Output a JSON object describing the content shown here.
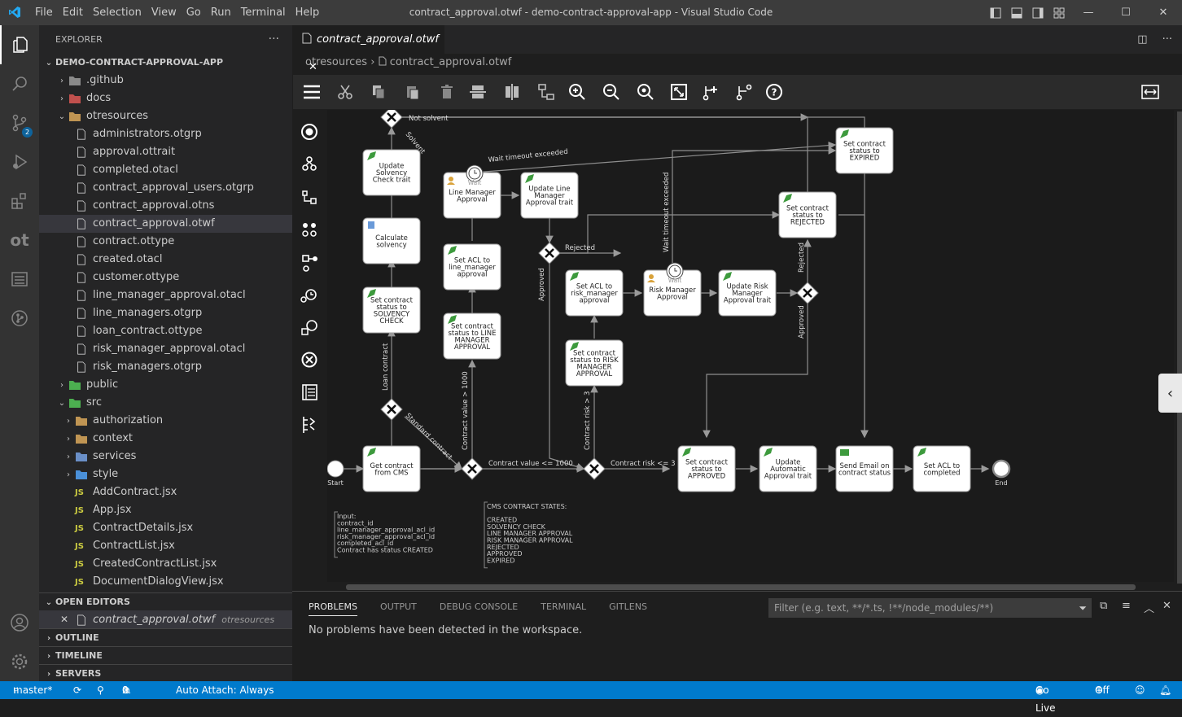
{
  "window": {
    "title": "contract_approval.otwf - demo-contract-approval-app - Visual Studio Code"
  },
  "menu": [
    "File",
    "Edit",
    "Selection",
    "View",
    "Go",
    "Run",
    "Terminal",
    "Help"
  ],
  "activity": {
    "scm_badge": "2"
  },
  "explorer": {
    "title": "EXPLORER",
    "root": "DEMO-CONTRACT-APPROVAL-APP",
    "items": [
      {
        "label": ".github",
        "kind": "folder",
        "depth": 1,
        "state": "closed",
        "color": "#8a8a8a"
      },
      {
        "label": "docs",
        "kind": "folder",
        "depth": 1,
        "state": "closed",
        "color": "#c0504d"
      },
      {
        "label": "otresources",
        "kind": "folder",
        "depth": 1,
        "state": "open",
        "color": "#c09553"
      },
      {
        "label": "administrators.otgrp",
        "kind": "file",
        "depth": 2
      },
      {
        "label": "approval.ottrait",
        "kind": "file",
        "depth": 2
      },
      {
        "label": "completed.otacl",
        "kind": "file",
        "depth": 2
      },
      {
        "label": "contract_approval_users.otgrp",
        "kind": "file",
        "depth": 2
      },
      {
        "label": "contract_approval.otns",
        "kind": "file",
        "depth": 2
      },
      {
        "label": "contract_approval.otwf",
        "kind": "file",
        "depth": 2,
        "selected": true
      },
      {
        "label": "contract.ottype",
        "kind": "file",
        "depth": 2
      },
      {
        "label": "created.otacl",
        "kind": "file",
        "depth": 2
      },
      {
        "label": "customer.ottype",
        "kind": "file",
        "depth": 2
      },
      {
        "label": "line_manager_approval.otacl",
        "kind": "file",
        "depth": 2
      },
      {
        "label": "line_managers.otgrp",
        "kind": "file",
        "depth": 2
      },
      {
        "label": "loan_contract.ottype",
        "kind": "file",
        "depth": 2
      },
      {
        "label": "risk_manager_approval.otacl",
        "kind": "file",
        "depth": 2
      },
      {
        "label": "risk_managers.otgrp",
        "kind": "file",
        "depth": 2
      },
      {
        "label": "public",
        "kind": "folder",
        "depth": 1,
        "state": "closed",
        "color": "#4caf50"
      },
      {
        "label": "src",
        "kind": "folder",
        "depth": 1,
        "state": "open",
        "color": "#4caf50"
      },
      {
        "label": "authorization",
        "kind": "folder",
        "depth": 2,
        "state": "closed",
        "color": "#c09553"
      },
      {
        "label": "context",
        "kind": "folder",
        "depth": 2,
        "state": "closed",
        "color": "#c09553"
      },
      {
        "label": "services",
        "kind": "folder",
        "depth": 2,
        "state": "closed",
        "color": "#6a8fc7"
      },
      {
        "label": "style",
        "kind": "folder",
        "depth": 2,
        "state": "closed",
        "color": "#4a90d9"
      },
      {
        "label": "AddContract.jsx",
        "kind": "js",
        "depth": 2
      },
      {
        "label": "App.jsx",
        "kind": "js",
        "depth": 2
      },
      {
        "label": "ContractDetails.jsx",
        "kind": "js",
        "depth": 2
      },
      {
        "label": "ContractList.jsx",
        "kind": "js",
        "depth": 2
      },
      {
        "label": "CreatedContractList.jsx",
        "kind": "js",
        "depth": 2
      },
      {
        "label": "DocumentDialogView.jsx",
        "kind": "js",
        "depth": 2
      }
    ],
    "open_editors": {
      "title": "OPEN EDITORS",
      "file": "contract_approval.otwf",
      "folder": "otresources"
    },
    "sections": [
      "OUTLINE",
      "TIMELINE",
      "SERVERS"
    ]
  },
  "editor": {
    "tab": "contract_approval.otwf",
    "breadcrumb": [
      "otresources",
      "contract_approval.otwf"
    ]
  },
  "diagram": {
    "nodes": {
      "start": "Start",
      "end": "End",
      "get_contract": "Get contract\nfrom CMS",
      "set_solvency": "Set contract\nstatus to\nSOLVENCY\nCHECK",
      "calc_solvency": "Calculate\nsolvency",
      "update_solvency": "Update\nSolvency\nCheck trait",
      "wait_line": "Line Manager\nApproval",
      "update_line": "Update Line\nManager\nApproval trait",
      "set_acl_line": "Set ACL to\nline_manager\napproval",
      "set_line_status": "Set contract\nstatus to LINE\nMANAGER\nAPPROVAL",
      "set_acl_risk": "Set ACL to\nrisk_manager\napproval",
      "set_risk_status": "Set contract\nstatus to RISK\nMANAGER\nAPPROVAL",
      "wait_risk": "Risk Manager\nApproval",
      "update_risk": "Update Risk\nManager\nApproval trait",
      "expired": "Set contract\nstatus to\nEXPIRED",
      "rejected": "Set contract\nstatus to\nREJECTED",
      "approved": "Set contract\nstatus to\nAPPROVED",
      "auto_approval": "Update\nAutomatic\nApproval trait",
      "send_email": "Send Email on\ncontract status",
      "set_acl_completed": "Set ACL to\ncompleted",
      "wait_label": "Wait"
    },
    "edges": {
      "not_solvent": "Not solvent",
      "solvent": "Solvent",
      "wait_timeout": "Wait timeout exceeded",
      "rejected": "Rejected",
      "approved": "Approved",
      "loan_contract": "Loan contract",
      "standard_contract": "Standard contract",
      "value_gt": "Contract value > 1000",
      "value_le": "Contract value <= 1000",
      "risk_gt": "Contract risk > 3",
      "risk_le": "Contract risk <= 3"
    },
    "notes": {
      "input": [
        "Input:",
        "contract_id",
        "line_manager_approval_acl_id",
        "risk_manager_approval_acl_id",
        "completed_acl_id",
        "Contract has status CREATED"
      ],
      "states": [
        "CMS CONTRACT STATES:",
        "",
        "CREATED",
        "SOLVENCY CHECK",
        "LINE MANAGER APPROVAL",
        "RISK MANAGER APPROVAL",
        "REJECTED",
        "APPROVED",
        "EXPIRED"
      ]
    }
  },
  "panel": {
    "tabs": [
      "PROBLEMS",
      "OUTPUT",
      "DEBUG CONSOLE",
      "TERMINAL",
      "GITLENS"
    ],
    "filter_placeholder": "Filter (e.g. text, **/*.ts, !**/node_modules/**)",
    "message": "No problems have been detected in the workspace."
  },
  "statusbar": {
    "branch": "master*",
    "errors": "0",
    "warnings": "0",
    "auto_attach": "Auto Attach: Always",
    "go_live": "Go Live",
    "off": "Off"
  }
}
